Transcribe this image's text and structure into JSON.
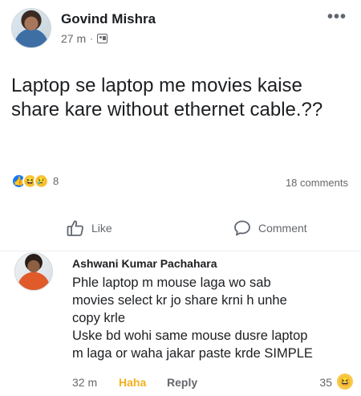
{
  "post": {
    "author": "Govind Mishra",
    "time": "27 m",
    "separator": "·",
    "text": "Laptop se laptop me movies kaise share kare without ethernet cable.??",
    "reaction_count": "8",
    "comments_count": "18 comments",
    "more_label": "•••"
  },
  "actions": {
    "like_label": "Like",
    "comment_label": "Comment"
  },
  "comment": {
    "author": "Ashwani Kumar Pachahara",
    "text_lines": [
      "Phle laptop m mouse laga wo sab",
      "movies select kr jo share krni h unhe",
      "copy krle",
      "Uske bd wohi same mouse dusre laptop",
      "m laga or waha jakar paste krde SIMPLE"
    ],
    "time": "32 m",
    "reaction_label": "Haha",
    "reply_label": "Reply",
    "reaction_count": "35"
  },
  "colors": {
    "like_blue": "#1877f2",
    "haha_yellow": "#f2b01e",
    "meta_gray": "#65676b"
  }
}
